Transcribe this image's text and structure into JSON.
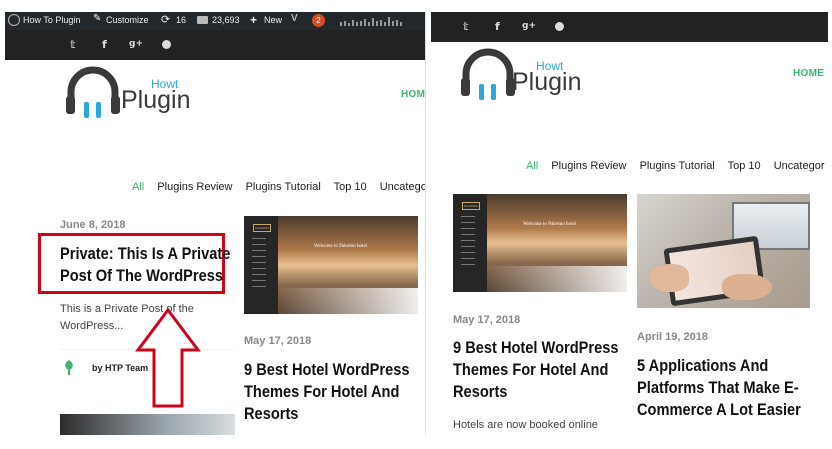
{
  "admin_bar": {
    "site_name": "How To Plugin",
    "customize": "Customize",
    "updates": "16",
    "comments": "23,693",
    "new": "New",
    "badge": "2"
  },
  "logo": {
    "text_how": "Howt",
    "text_plugin": "Plugin"
  },
  "nav": {
    "home": "HOME",
    "categories": [
      "All",
      "Plugins Review",
      "Plugins Tutorial",
      "Top 10",
      "Uncategor"
    ]
  },
  "thumb_text": {
    "logo": "PALERMO",
    "welcome": "Welcome to Palermo hotel"
  },
  "left": {
    "post1": {
      "date": "June 8, 2018",
      "title_line1": "Private: This Is A Private",
      "title_line2": "Post Of The WordPress",
      "excerpt_line1": "This is a Private Post of the",
      "excerpt_line2": "WordPress...",
      "author": "by HTP Team"
    },
    "post2": {
      "date": "May 17, 2018",
      "title_line1": "9 Best Hotel WordPress",
      "title_line2": "Themes For Hotel And",
      "title_line3": "Resorts"
    }
  },
  "right": {
    "post1": {
      "date": "May 17, 2018",
      "title_line1": "9 Best Hotel WordPress",
      "title_line2": "Themes For Hotel And",
      "title_line3": "Resorts",
      "excerpt": "Hotels are now booked online"
    },
    "post2": {
      "date": "April 19, 2018",
      "title_line1": "5 Applications And",
      "title_line2": "Platforms That Make E-",
      "title_line3": "Commerce A Lot Easier"
    }
  },
  "colors": {
    "accent_green": "#3cb371",
    "highlight_red": "#d0021b",
    "logo_blue": "#29a8e0",
    "logo_dark": "#3a3a3a",
    "admin_bar": "#23282d"
  },
  "icons": [
    "wordpress-icon",
    "customize-icon",
    "updates-icon",
    "comments-icon",
    "plus-icon",
    "twitter-icon",
    "facebook-icon",
    "googleplus-icon",
    "circle-icon",
    "leaf-icon"
  ]
}
